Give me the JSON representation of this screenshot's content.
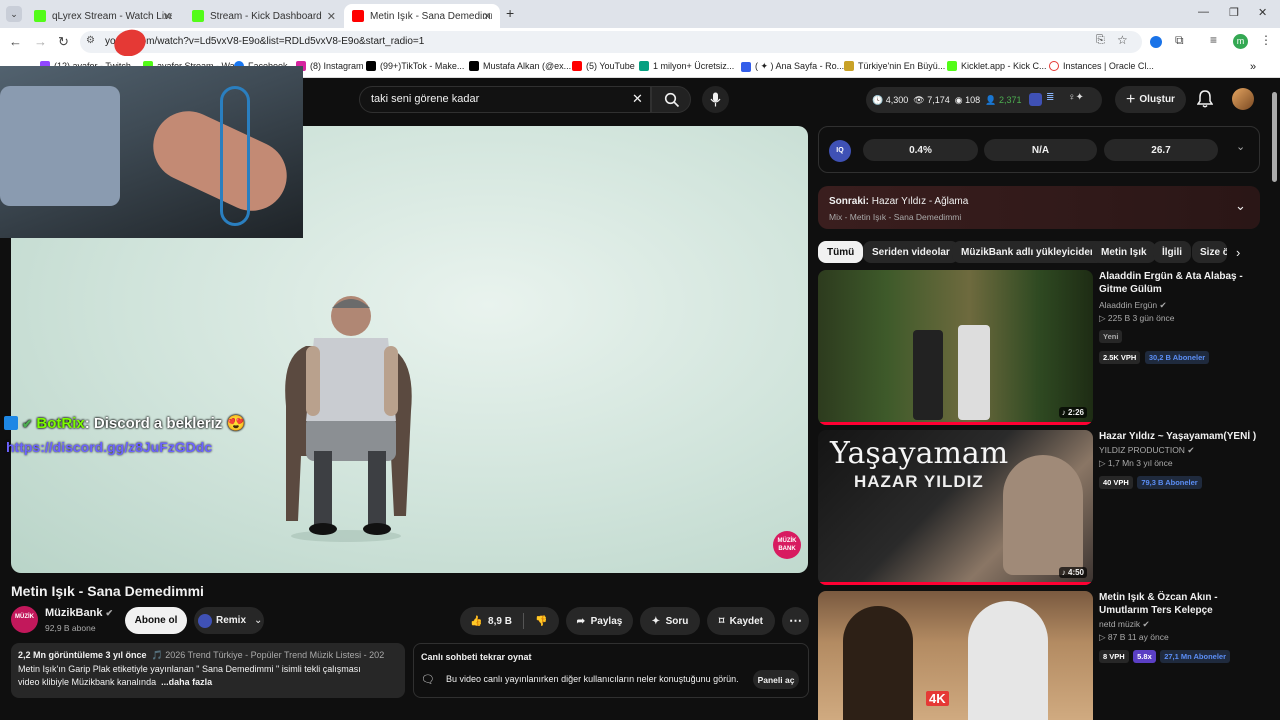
{
  "browser": {
    "tabs": [
      {
        "title": "qLyrex Stream - Watch Live on",
        "favicon_color": "#53fc18"
      },
      {
        "title": "Stream - Kick Dashboard",
        "favicon_color": "#53fc18"
      },
      {
        "title": "Metin Işık - Sana Demedimmi",
        "favicon_color": "#ff0000"
      }
    ],
    "new_tab": "+",
    "url": "yo         om/watch?v=Ld5vxV8-E9o&list=RDLd5vxV8-E9o&start_radio=1",
    "bookmarks": [
      "(12) ayafor - Twitch",
      "ayafor Stream - Wat...",
      "Facebook",
      "(8) Instagram",
      "(99+)TikTok - Make...",
      "Mustafa Alkan (@ex...",
      "(5) YouTube",
      "1 milyon+ Ücretsiz...",
      "( ✦ ) Ana Sayfa - Ro...",
      "Türkiye'nin En Büyü...",
      "Kicklet.app - Kick C...",
      "Instances | Oracle Cl..."
    ],
    "profile_letter": "m"
  },
  "search": {
    "query": "taki seni görene kadar"
  },
  "stats": {
    "a": "4,300",
    "b": "7,174",
    "c": "108",
    "d": "2,371"
  },
  "create_label": "Oluştur",
  "iq_panel": {
    "v1": "0.4%",
    "v2": "N/A",
    "v3": "26.7"
  },
  "next_up": {
    "label": "Sonraki:",
    "title": "Hazar Yıldız - Ağlama",
    "sub": "Mix - Metin Işık - Sana Demedimmi"
  },
  "chips": [
    "Tümü",
    "Seriden videolar",
    "MüzikBank adlı yükleyiciden",
    "Metin Işık",
    "İlgili",
    "Size ö"
  ],
  "overlay": {
    "bot_name": "BotRix",
    "message": ": Discord a bekleriz 😍",
    "link": "https://discord.gg/z8JuFzGDdc"
  },
  "watermark": "MÜZİK BANK",
  "video": {
    "title": "Metin Işık - Sana Demedimmi",
    "channel": "MüzikBank",
    "subscribers": "92,9 B abone",
    "subscribe_label": "Abone ol",
    "remix_label": "Remix",
    "likes": "8,9 B",
    "share_label": "Paylaş",
    "ask_label": "Soru",
    "save_label": "Kaydet",
    "desc_meta": "2,2 Mn görüntüleme  3 yıl önce",
    "desc_tag": "🎵 2026 Trend Türkiye - Popüler Trend Müzik Listesi - 202",
    "desc_line1": "Metin Işık'ın Garip Plak etiketiyle yayınlanan  \" Sana Demedimmi \"  isimli tekli çalışması",
    "desc_line2": "video klibiyle Müzikbank kanalında",
    "more": "...daha fazla"
  },
  "chat_replay": {
    "title": "Canlı sohbeti tekrar oynat",
    "text": "Bu video canlı yayınlanırken diğer kullanıcıların neler konuştuğunu görün.",
    "button": "Paneli aç"
  },
  "recommendations": [
    {
      "title": "Alaaddin Ergün & Ata Alabaş - Gitme Gülüm",
      "channel": "Alaaddin Ergün",
      "meta": "▷ 225 B  3 gün önce",
      "new": "Yeni",
      "vph": "2.5K VPH",
      "subs": "30,2 B Aboneler",
      "duration": "♪ 2:26"
    },
    {
      "title": "Hazar Yıldız ~ Yaşayamam(YENİ )",
      "channel": "YILDIZ PRODUCTION",
      "meta": "▷ 1,7 Mn  3 yıl önce",
      "vph": "40 VPH",
      "subs": "79,3 B Aboneler",
      "duration": "♪ 4:50",
      "thumb_text": "Yaşayamam",
      "thumb_sub": "HAZAR YILDIZ"
    },
    {
      "title": "Metin Işık & Özcan Akın - Umutlarım Ters Kelepçe",
      "channel": "netd müzik",
      "meta": "▷ 87 B  11 ay önce",
      "vph": "8 VPH",
      "ratio": "5.8x",
      "subs": "27,1 Mn Aboneler",
      "thumb_text": "4K"
    }
  ]
}
